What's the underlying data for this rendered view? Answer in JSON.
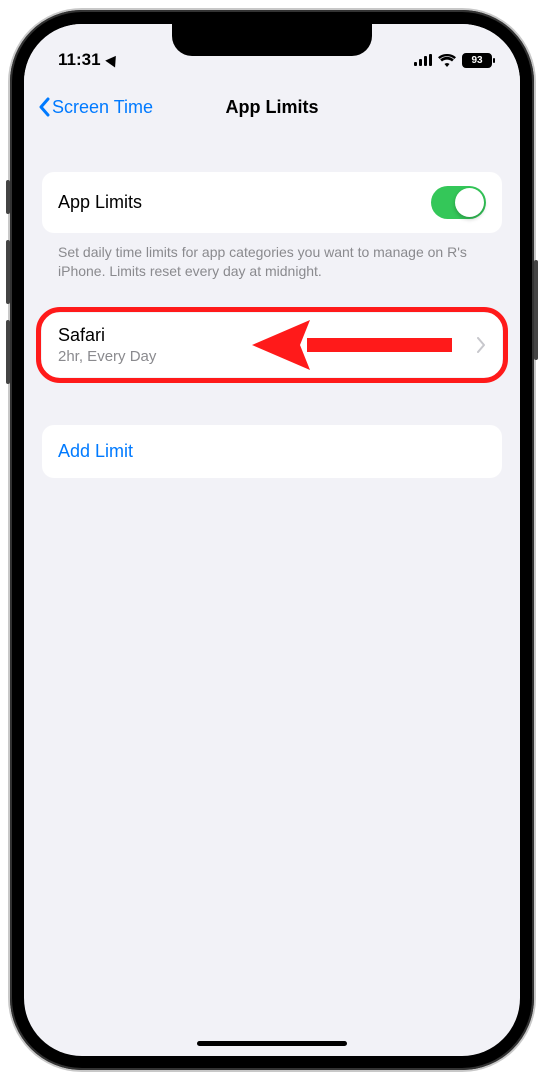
{
  "status": {
    "time": "11:31",
    "battery": "93"
  },
  "nav": {
    "back_label": "Screen Time",
    "title": "App Limits"
  },
  "toggle_section": {
    "label": "App Limits",
    "footer": "Set daily time limits for app categories you want to manage on R's iPhone. Limits reset every day at midnight."
  },
  "limit": {
    "title": "Safari",
    "subtitle": "2hr, Every Day"
  },
  "add_limit": {
    "label": "Add Limit"
  }
}
